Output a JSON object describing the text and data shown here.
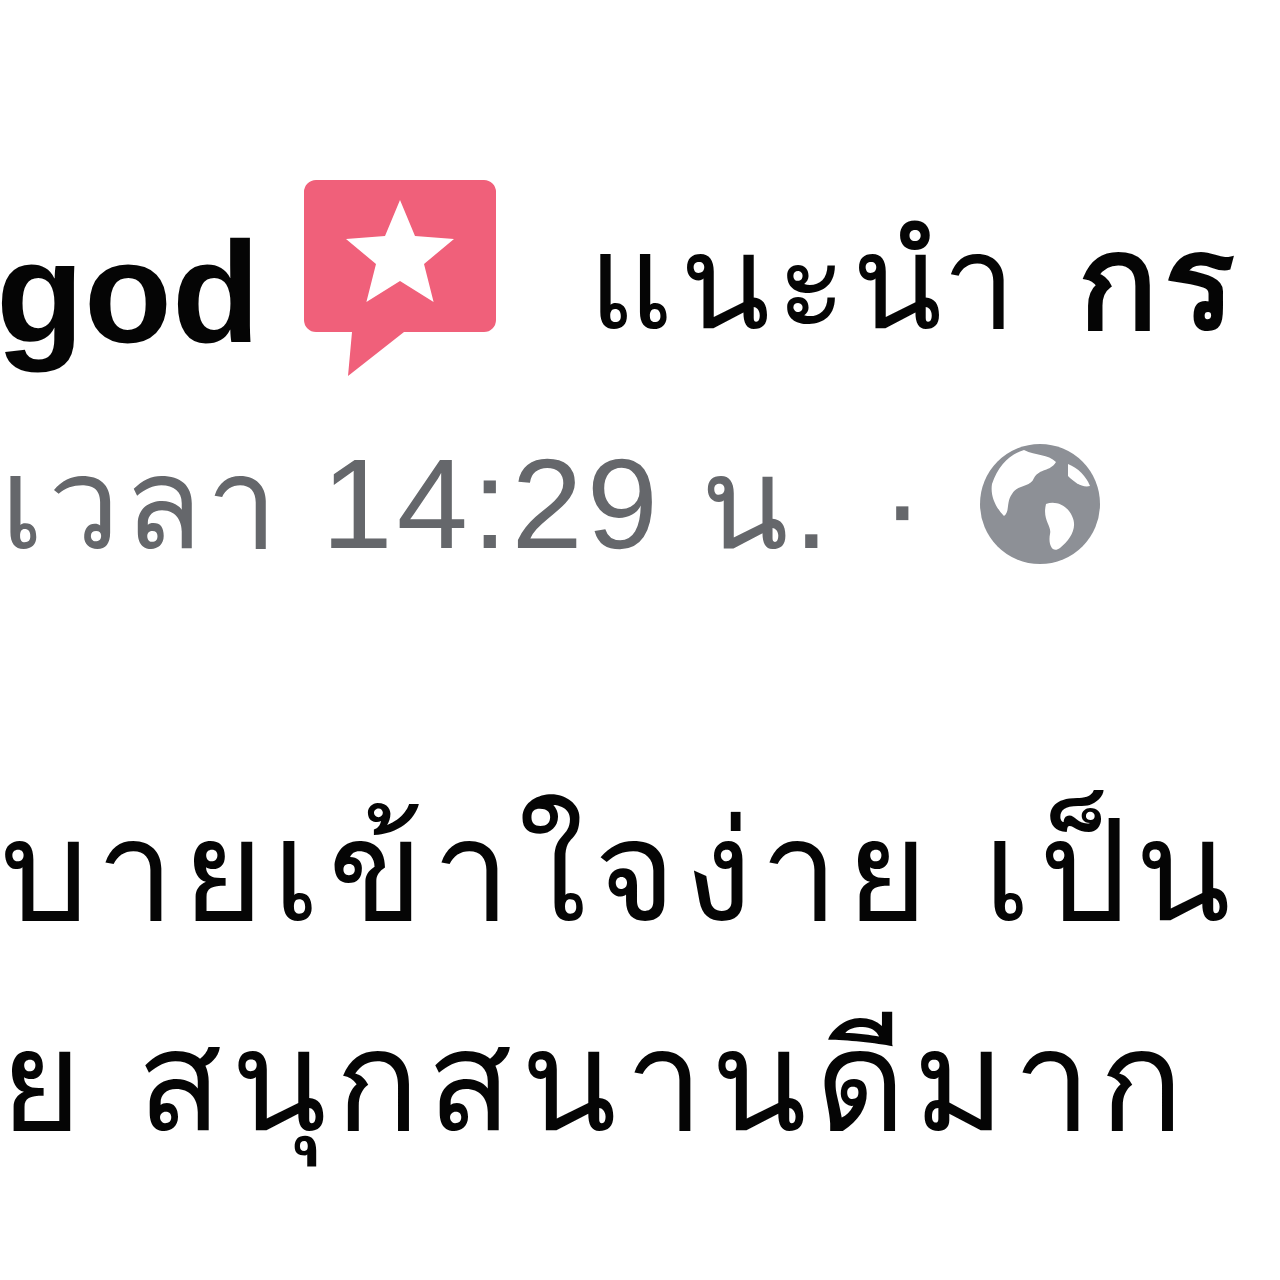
{
  "header": {
    "author": "god",
    "action": "แนะนำ",
    "page": "กร"
  },
  "meta": {
    "time": "เวลา 14:29 น.",
    "separator": "·"
  },
  "body": {
    "lines": [
      "บายเข้าใจง่าย เป็น",
      "ย สนุกสนานดีมาก"
    ]
  }
}
